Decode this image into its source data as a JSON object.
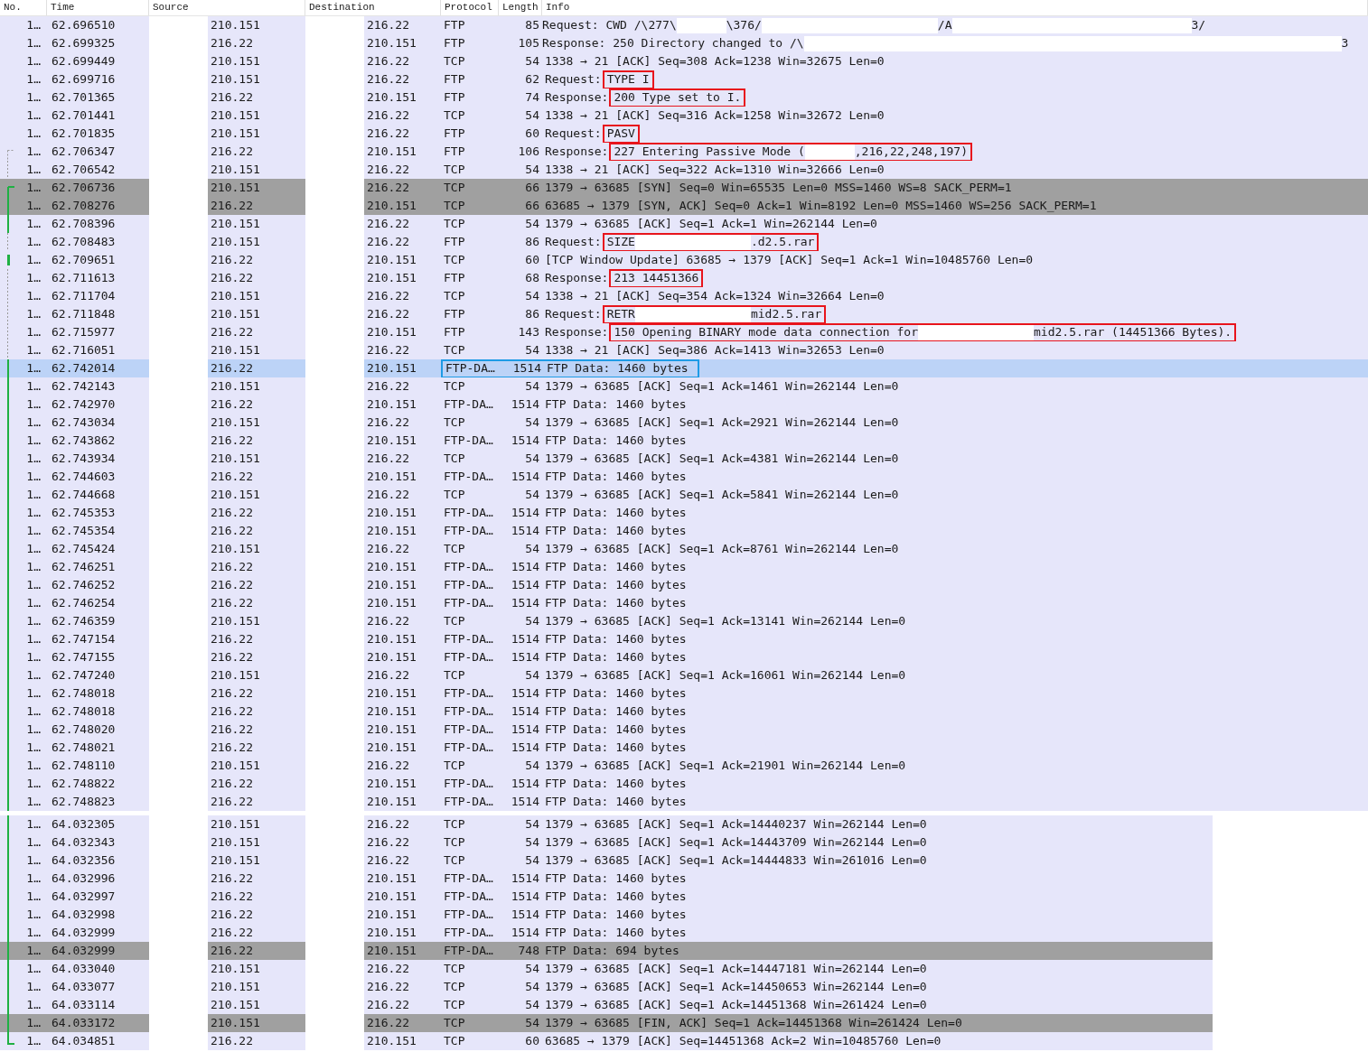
{
  "columns": [
    "No.",
    "Time",
    "Source",
    "Destination",
    "Protocol",
    "Length",
    "Info"
  ],
  "packets": [
    {
      "no": "1…",
      "time": "62.696510",
      "source": "210.151",
      "destination": "216.22",
      "protocol": "FTP",
      "length": "85",
      "info": [
        {
          "text": "Request: CWD /\\277\\"
        },
        {
          "kind": "short"
        },
        {
          "text": "\\376/"
        },
        {
          "kind": "long"
        },
        {
          "text": "/A"
        },
        {
          "kind": "longer"
        },
        {
          "text": "3/"
        }
      ],
      "color": "#e6e6fa",
      "selected": false,
      "outlined": false
    },
    {
      "no": "1…",
      "time": "62.699325",
      "source": "216.22",
      "destination": "210.151",
      "protocol": "FTP",
      "length": "105",
      "info": [
        {
          "text": "Response: 250 Directory changed to /\\"
        },
        {
          "kind": "full"
        },
        {
          "text": "3"
        }
      ],
      "color": "#e6e6fa",
      "selected": false,
      "outlined": false
    },
    {
      "no": "1…",
      "time": "62.699449",
      "source": "210.151",
      "destination": "216.22",
      "protocol": "TCP",
      "length": "54",
      "info": "1338 → 21 [ACK] Seq=308 Ack=1238 Win=32675 Len=0",
      "color": "#e6e6fa",
      "selected": false,
      "outlined": false
    },
    {
      "no": "1…",
      "time": "62.699716",
      "source": "210.151",
      "destination": "216.22",
      "protocol": "FTP",
      "length": "62",
      "info": "Request:",
      "callout": [
        {
          "text": "TYPE I"
        }
      ],
      "color": "#e6e6fa",
      "selected": false,
      "outlined": false
    },
    {
      "no": "1…",
      "time": "62.701365",
      "source": "216.22",
      "destination": "210.151",
      "protocol": "FTP",
      "length": "74",
      "info": "Response:",
      "callout": [
        {
          "text": "200 Type set to I."
        }
      ],
      "color": "#e6e6fa",
      "selected": false,
      "outlined": false
    },
    {
      "no": "1…",
      "time": "62.701441",
      "source": "210.151",
      "destination": "216.22",
      "protocol": "TCP",
      "length": "54",
      "info": "1338 → 21 [ACK] Seq=316 Ack=1258 Win=32672 Len=0",
      "color": "#e6e6fa",
      "selected": false,
      "outlined": false
    },
    {
      "no": "1…",
      "time": "62.701835",
      "source": "210.151",
      "destination": "216.22",
      "protocol": "FTP",
      "length": "60",
      "info": "Request:",
      "callout": [
        {
          "text": "PASV"
        }
      ],
      "color": "#e6e6fa",
      "selected": false,
      "outlined": false
    },
    {
      "no": "1…",
      "time": "62.706347",
      "source": "216.22",
      "destination": "210.151",
      "protocol": "FTP",
      "length": "106",
      "info": "Response:",
      "callout": [
        {
          "text": "227 Entering Passive Mode ("
        },
        {
          "kind": "short"
        },
        {
          "text": ",216,22,248,197)"
        }
      ],
      "color": "#e6e6fa",
      "selected": false,
      "outlined": false,
      "thread": {
        "kind": "dim-start"
      }
    },
    {
      "no": "1…",
      "time": "62.706542",
      "source": "210.151",
      "destination": "216.22",
      "protocol": "TCP",
      "length": "54",
      "info": "1338 → 21 [ACK] Seq=322 Ack=1310 Win=32666 Len=0",
      "color": "#e6e6fa",
      "selected": false,
      "outlined": false,
      "thread": {
        "kind": "dim-line"
      }
    },
    {
      "no": "1…",
      "time": "62.706736",
      "source": "210.151",
      "destination": "216.22",
      "protocol": "TCP",
      "length": "66",
      "info": "1379 → 63685 [SYN] Seq=0 Win=65535 Len=0 MSS=1460 WS=8 SACK_PERM=1",
      "color": "#a0a0a0",
      "selected": false,
      "outlined": false,
      "thread": {
        "kind": "start"
      }
    },
    {
      "no": "1…",
      "time": "62.708276",
      "source": "216.22",
      "destination": "210.151",
      "protocol": "TCP",
      "length": "66",
      "info": "63685 → 1379 [SYN, ACK] Seq=0 Ack=1 Win=8192 Len=0 MSS=1460 WS=256 SACK_PERM=1",
      "color": "#a0a0a0",
      "selected": false,
      "outlined": false,
      "thread": {
        "kind": "line"
      }
    },
    {
      "no": "1…",
      "time": "62.708396",
      "source": "210.151",
      "destination": "216.22",
      "protocol": "TCP",
      "length": "54",
      "info": "1379 → 63685 [ACK] Seq=1 Ack=1 Win=262144 Len=0",
      "color": "#e6e6fa",
      "selected": false,
      "outlined": false,
      "thread": {
        "kind": "line"
      }
    },
    {
      "no": "1…",
      "time": "62.708483",
      "source": "210.151",
      "destination": "216.22",
      "protocol": "FTP",
      "length": "86",
      "info": "Request:",
      "callout": [
        {
          "text": "SIZE"
        },
        {
          "kind": "medium"
        },
        {
          "text": ".d2.5.rar"
        }
      ],
      "color": "#e6e6fa",
      "selected": false,
      "outlined": false,
      "thread": {
        "kind": "dim-line"
      }
    },
    {
      "no": "1…",
      "time": "62.709651",
      "source": "216.22",
      "destination": "210.151",
      "protocol": "TCP",
      "length": "60",
      "info": "[TCP Window Update] 63685 → 1379 [ACK] Seq=1 Ack=1 Win=10485760 Len=0",
      "color": "#e6e6fa",
      "selected": false,
      "outlined": false,
      "thread": {
        "kind": "mark"
      }
    },
    {
      "no": "1…",
      "time": "62.711613",
      "source": "216.22",
      "destination": "210.151",
      "protocol": "FTP",
      "length": "68",
      "info": "Response:",
      "callout": [
        {
          "text": "213 14451366"
        }
      ],
      "color": "#e6e6fa",
      "selected": false,
      "outlined": false,
      "thread": {
        "kind": "dim-line"
      }
    },
    {
      "no": "1…",
      "time": "62.711704",
      "source": "210.151",
      "destination": "216.22",
      "protocol": "TCP",
      "length": "54",
      "info": "1338 → 21 [ACK] Seq=354 Ack=1324 Win=32664 Len=0",
      "color": "#e6e6fa",
      "selected": false,
      "outlined": false,
      "thread": {
        "kind": "dim-line"
      }
    },
    {
      "no": "1…",
      "time": "62.711848",
      "source": "210.151",
      "destination": "216.22",
      "protocol": "FTP",
      "length": "86",
      "info": "Request:",
      "callout": [
        {
          "text": "RETR"
        },
        {
          "kind": "medium"
        },
        {
          "text": "mid2.5.rar"
        }
      ],
      "color": "#e6e6fa",
      "selected": false,
      "outlined": false,
      "thread": {
        "kind": "dim-line"
      }
    },
    {
      "no": "1…",
      "time": "62.715977",
      "source": "216.22",
      "destination": "210.151",
      "protocol": "FTP",
      "length": "143",
      "info": "Response:",
      "callout": [
        {
          "text": "150 Opening BINARY mode data connection for"
        },
        {
          "kind": "medium"
        },
        {
          "text": "mid2.5.rar (14451366 Bytes)."
        }
      ],
      "color": "#e6e6fa",
      "selected": false,
      "outlined": false,
      "thread": {
        "kind": "dim-line"
      }
    },
    {
      "no": "1…",
      "time": "62.716051",
      "source": "210.151",
      "destination": "216.22",
      "protocol": "TCP",
      "length": "54",
      "info": "1338 → 21 [ACK] Seq=386 Ack=1413 Win=32653 Len=0",
      "color": "#e6e6fa",
      "selected": false,
      "outlined": false,
      "thread": {
        "kind": "dim-line"
      }
    },
    {
      "no": "1…",
      "time": "62.742014",
      "source": "216.22",
      "destination": "210.151",
      "protocol": "FTP-DA…",
      "length": "1514",
      "info": "FTP Data: 1460 bytes",
      "selected": true,
      "outlined": true,
      "thread": {
        "kind": "line"
      }
    },
    {
      "no": "1…",
      "time": "62.742143",
      "source": "210.151",
      "destination": "216.22",
      "protocol": "TCP",
      "length": "54",
      "info": "1379 → 63685 [ACK] Seq=1 Ack=1461 Win=262144 Len=0",
      "color": "#e6e6fa",
      "selected": false,
      "outlined": false,
      "thread": {
        "kind": "line"
      }
    },
    {
      "no": "1…",
      "time": "62.742970",
      "source": "216.22",
      "destination": "210.151",
      "protocol": "FTP-DA…",
      "length": "1514",
      "info": "FTP Data: 1460 bytes",
      "color": "#e6e6fa",
      "selected": false,
      "outlined": false,
      "thread": {
        "kind": "line"
      }
    },
    {
      "no": "1…",
      "time": "62.743034",
      "source": "210.151",
      "destination": "216.22",
      "protocol": "TCP",
      "length": "54",
      "info": "1379 → 63685 [ACK] Seq=1 Ack=2921 Win=262144 Len=0",
      "color": "#e6e6fa",
      "selected": false,
      "outlined": false,
      "thread": {
        "kind": "line"
      }
    },
    {
      "no": "1…",
      "time": "62.743862",
      "source": "216.22",
      "destination": "210.151",
      "protocol": "FTP-DA…",
      "length": "1514",
      "info": "FTP Data: 1460 bytes",
      "color": "#e6e6fa",
      "selected": false,
      "outlined": false,
      "thread": {
        "kind": "line"
      }
    },
    {
      "no": "1…",
      "time": "62.743934",
      "source": "210.151",
      "destination": "216.22",
      "protocol": "TCP",
      "length": "54",
      "info": "1379 → 63685 [ACK] Seq=1 Ack=4381 Win=262144 Len=0",
      "color": "#e6e6fa",
      "selected": false,
      "outlined": false,
      "thread": {
        "kind": "line"
      }
    },
    {
      "no": "1…",
      "time": "62.744603",
      "source": "216.22",
      "destination": "210.151",
      "protocol": "FTP-DA…",
      "length": "1514",
      "info": "FTP Data: 1460 bytes",
      "color": "#e6e6fa",
      "selected": false,
      "outlined": false,
      "thread": {
        "kind": "line"
      }
    },
    {
      "no": "1…",
      "time": "62.744668",
      "source": "210.151",
      "destination": "216.22",
      "protocol": "TCP",
      "length": "54",
      "info": "1379 → 63685 [ACK] Seq=1 Ack=5841 Win=262144 Len=0",
      "color": "#e6e6fa",
      "selected": false,
      "outlined": false,
      "thread": {
        "kind": "line"
      }
    },
    {
      "no": "1…",
      "time": "62.745353",
      "source": "216.22",
      "destination": "210.151",
      "protocol": "FTP-DA…",
      "length": "1514",
      "info": "FTP Data: 1460 bytes",
      "color": "#e6e6fa",
      "selected": false,
      "outlined": false,
      "thread": {
        "kind": "line"
      }
    },
    {
      "no": "1…",
      "time": "62.745354",
      "source": "216.22",
      "destination": "210.151",
      "protocol": "FTP-DA…",
      "length": "1514",
      "info": "FTP Data: 1460 bytes",
      "color": "#e6e6fa",
      "selected": false,
      "outlined": false,
      "thread": {
        "kind": "line"
      }
    },
    {
      "no": "1…",
      "time": "62.745424",
      "source": "210.151",
      "destination": "216.22",
      "protocol": "TCP",
      "length": "54",
      "info": "1379 → 63685 [ACK] Seq=1 Ack=8761 Win=262144 Len=0",
      "color": "#e6e6fa",
      "selected": false,
      "outlined": false,
      "thread": {
        "kind": "line"
      }
    },
    {
      "no": "1…",
      "time": "62.746251",
      "source": "216.22",
      "destination": "210.151",
      "protocol": "FTP-DA…",
      "length": "1514",
      "info": "FTP Data: 1460 bytes",
      "color": "#e6e6fa",
      "selected": false,
      "outlined": false,
      "thread": {
        "kind": "line"
      }
    },
    {
      "no": "1…",
      "time": "62.746252",
      "source": "216.22",
      "destination": "210.151",
      "protocol": "FTP-DA…",
      "length": "1514",
      "info": "FTP Data: 1460 bytes",
      "color": "#e6e6fa",
      "selected": false,
      "outlined": false,
      "thread": {
        "kind": "line"
      }
    },
    {
      "no": "1…",
      "time": "62.746254",
      "source": "216.22",
      "destination": "210.151",
      "protocol": "FTP-DA…",
      "length": "1514",
      "info": "FTP Data: 1460 bytes",
      "color": "#e6e6fa",
      "selected": false,
      "outlined": false,
      "thread": {
        "kind": "line"
      }
    },
    {
      "no": "1…",
      "time": "62.746359",
      "source": "210.151",
      "destination": "216.22",
      "protocol": "TCP",
      "length": "54",
      "info": "1379 → 63685 [ACK] Seq=1 Ack=13141 Win=262144 Len=0",
      "color": "#e6e6fa",
      "selected": false,
      "outlined": false,
      "thread": {
        "kind": "line"
      }
    },
    {
      "no": "1…",
      "time": "62.747154",
      "source": "216.22",
      "destination": "210.151",
      "protocol": "FTP-DA…",
      "length": "1514",
      "info": "FTP Data: 1460 bytes",
      "color": "#e6e6fa",
      "selected": false,
      "outlined": false,
      "thread": {
        "kind": "line"
      }
    },
    {
      "no": "1…",
      "time": "62.747155",
      "source": "216.22",
      "destination": "210.151",
      "protocol": "FTP-DA…",
      "length": "1514",
      "info": "FTP Data: 1460 bytes",
      "color": "#e6e6fa",
      "selected": false,
      "outlined": false,
      "thread": {
        "kind": "line"
      }
    },
    {
      "no": "1…",
      "time": "62.747240",
      "source": "210.151",
      "destination": "216.22",
      "protocol": "TCP",
      "length": "54",
      "info": "1379 → 63685 [ACK] Seq=1 Ack=16061 Win=262144 Len=0",
      "color": "#e6e6fa",
      "selected": false,
      "outlined": false,
      "thread": {
        "kind": "line"
      }
    },
    {
      "no": "1…",
      "time": "62.748018",
      "source": "216.22",
      "destination": "210.151",
      "protocol": "FTP-DA…",
      "length": "1514",
      "info": "FTP Data: 1460 bytes",
      "color": "#e6e6fa",
      "selected": false,
      "outlined": false,
      "thread": {
        "kind": "line"
      }
    },
    {
      "no": "1…",
      "time": "62.748018",
      "source": "216.22",
      "destination": "210.151",
      "protocol": "FTP-DA…",
      "length": "1514",
      "info": "FTP Data: 1460 bytes",
      "color": "#e6e6fa",
      "selected": false,
      "outlined": false,
      "thread": {
        "kind": "line"
      }
    },
    {
      "no": "1…",
      "time": "62.748020",
      "source": "216.22",
      "destination": "210.151",
      "protocol": "FTP-DA…",
      "length": "1514",
      "info": "FTP Data: 1460 bytes",
      "color": "#e6e6fa",
      "selected": false,
      "outlined": false,
      "thread": {
        "kind": "line"
      }
    },
    {
      "no": "1…",
      "time": "62.748021",
      "source": "216.22",
      "destination": "210.151",
      "protocol": "FTP-DA…",
      "length": "1514",
      "info": "FTP Data: 1460 bytes",
      "color": "#e6e6fa",
      "selected": false,
      "outlined": false,
      "thread": {
        "kind": "line"
      }
    },
    {
      "no": "1…",
      "time": "62.748110",
      "source": "210.151",
      "destination": "216.22",
      "protocol": "TCP",
      "length": "54",
      "info": "1379 → 63685 [ACK] Seq=1 Ack=21901 Win=262144 Len=0",
      "color": "#e6e6fa",
      "selected": false,
      "outlined": false,
      "thread": {
        "kind": "line"
      }
    },
    {
      "no": "1…",
      "time": "62.748822",
      "source": "216.22",
      "destination": "210.151",
      "protocol": "FTP-DA…",
      "length": "1514",
      "info": "FTP Data: 1460 bytes",
      "color": "#e6e6fa",
      "selected": false,
      "outlined": false,
      "thread": {
        "kind": "line"
      }
    },
    {
      "no": "1…",
      "time": "62.748823",
      "source": "216.22",
      "destination": "210.151",
      "protocol": "FTP-DA…",
      "length": "1514",
      "info": "FTP Data: 1460 bytes",
      "color": "#e6e6fa",
      "selected": false,
      "outlined": false,
      "thread": {
        "kind": "line"
      }
    }
  ],
  "packets_continued": [
    {
      "no": "1…",
      "time": "64.032305",
      "source": "210.151",
      "destination": "216.22",
      "protocol": "TCP",
      "length": "54",
      "info": "1379 → 63685 [ACK] Seq=1 Ack=14440237 Win=262144 Len=0",
      "color": "#e6e6fa",
      "selected": false,
      "outlined": false,
      "thread": {
        "kind": "line"
      }
    },
    {
      "no": "1…",
      "time": "64.032343",
      "source": "210.151",
      "destination": "216.22",
      "protocol": "TCP",
      "length": "54",
      "info": "1379 → 63685 [ACK] Seq=1 Ack=14443709 Win=262144 Len=0",
      "color": "#e6e6fa",
      "selected": false,
      "outlined": false,
      "thread": {
        "kind": "line"
      }
    },
    {
      "no": "1…",
      "time": "64.032356",
      "source": "210.151",
      "destination": "216.22",
      "protocol": "TCP",
      "length": "54",
      "info": "1379 → 63685 [ACK] Seq=1 Ack=14444833 Win=261016 Len=0",
      "color": "#e6e6fa",
      "selected": false,
      "outlined": false,
      "thread": {
        "kind": "line"
      }
    },
    {
      "no": "1…",
      "time": "64.032996",
      "source": "216.22",
      "destination": "210.151",
      "protocol": "FTP-DA…",
      "length": "1514",
      "info": "FTP Data: 1460 bytes",
      "color": "#e6e6fa",
      "selected": false,
      "outlined": false,
      "thread": {
        "kind": "line"
      }
    },
    {
      "no": "1…",
      "time": "64.032997",
      "source": "216.22",
      "destination": "210.151",
      "protocol": "FTP-DA…",
      "length": "1514",
      "info": "FTP Data: 1460 bytes",
      "color": "#e6e6fa",
      "selected": false,
      "outlined": false,
      "thread": {
        "kind": "line"
      }
    },
    {
      "no": "1…",
      "time": "64.032998",
      "source": "216.22",
      "destination": "210.151",
      "protocol": "FTP-DA…",
      "length": "1514",
      "info": "FTP Data: 1460 bytes",
      "color": "#e6e6fa",
      "selected": false,
      "outlined": false,
      "thread": {
        "kind": "line"
      }
    },
    {
      "no": "1…",
      "time": "64.032999",
      "source": "216.22",
      "destination": "210.151",
      "protocol": "FTP-DA…",
      "length": "1514",
      "info": "FTP Data: 1460 bytes",
      "color": "#e6e6fa",
      "selected": false,
      "outlined": false,
      "thread": {
        "kind": "line"
      }
    },
    {
      "no": "1…",
      "time": "64.032999",
      "source": "216.22",
      "destination": "210.151",
      "protocol": "FTP-DA…",
      "length": "748",
      "info": "FTP Data: 694 bytes",
      "color": "#a0a0a0",
      "selected": false,
      "outlined": false,
      "thread": {
        "kind": "line"
      }
    },
    {
      "no": "1…",
      "time": "64.033040",
      "source": "210.151",
      "destination": "216.22",
      "protocol": "TCP",
      "length": "54",
      "info": "1379 → 63685 [ACK] Seq=1 Ack=14447181 Win=262144 Len=0",
      "color": "#e6e6fa",
      "selected": false,
      "outlined": false,
      "thread": {
        "kind": "line"
      }
    },
    {
      "no": "1…",
      "time": "64.033077",
      "source": "210.151",
      "destination": "216.22",
      "protocol": "TCP",
      "length": "54",
      "info": "1379 → 63685 [ACK] Seq=1 Ack=14450653 Win=262144 Len=0",
      "color": "#e6e6fa",
      "selected": false,
      "outlined": false,
      "thread": {
        "kind": "line"
      }
    },
    {
      "no": "1…",
      "time": "64.033114",
      "source": "210.151",
      "destination": "216.22",
      "protocol": "TCP",
      "length": "54",
      "info": "1379 → 63685 [ACK] Seq=1 Ack=14451368 Win=261424 Len=0",
      "color": "#e6e6fa",
      "selected": false,
      "outlined": false,
      "thread": {
        "kind": "line"
      }
    },
    {
      "no": "1…",
      "time": "64.033172",
      "source": "210.151",
      "destination": "216.22",
      "protocol": "TCP",
      "length": "54",
      "info": "1379 → 63685 [FIN, ACK] Seq=1 Ack=14451368 Win=261424 Len=0",
      "color": "#a0a0a0",
      "selected": false,
      "outlined": false,
      "thread": {
        "kind": "line"
      }
    },
    {
      "no": "1…",
      "time": "64.034851",
      "source": "216.22",
      "destination": "210.151",
      "protocol": "TCP",
      "length": "60",
      "info": "63685 → 1379 [ACK] Seq=14451368 Ack=2 Win=10485760 Len=0",
      "color": "#e6e6fa",
      "selected": false,
      "outlined": false,
      "thread": {
        "kind": "end"
      }
    }
  ]
}
